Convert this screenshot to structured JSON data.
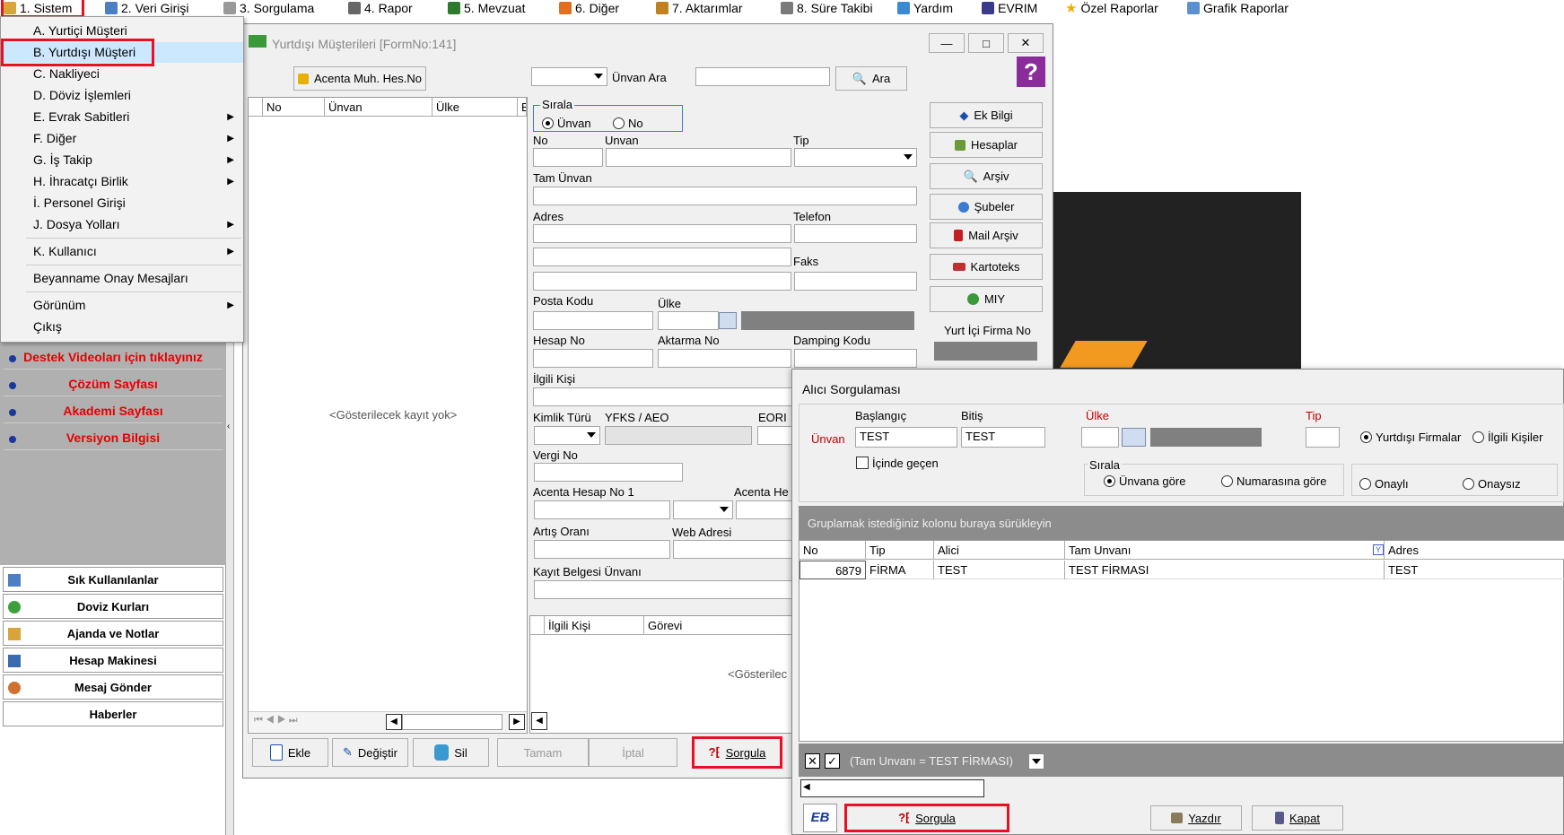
{
  "menubar": {
    "items": [
      {
        "label": "1.  Sistem"
      },
      {
        "label": "2.  Veri Girişi"
      },
      {
        "label": "3.  Sorgulama"
      },
      {
        "label": "4.  Rapor"
      },
      {
        "label": "5.  Mevzuat"
      },
      {
        "label": "6.  Diğer"
      },
      {
        "label": "7.  Aktarımlar"
      },
      {
        "label": "8. Süre Takibi"
      },
      {
        "label": "Yardım"
      },
      {
        "label": "EVRIM"
      },
      {
        "label": "Özel Raporlar"
      },
      {
        "label": "Grafik Raporlar"
      }
    ]
  },
  "dropdown": {
    "items": [
      {
        "label": "A.  Yurtiçi Müşteri"
      },
      {
        "label": "B.  Yurtdışı Müşteri"
      },
      {
        "label": "C.  Nakliyeci"
      },
      {
        "label": "D.  Döviz İşlemleri"
      },
      {
        "label": "E.  Evrak Sabitleri"
      },
      {
        "label": "F.  Diğer"
      },
      {
        "label": "G.  İş Takip"
      },
      {
        "label": "H.  İhracatçı Birlik"
      },
      {
        "label": "İ.   Personel Girişi"
      },
      {
        "label": "J.  Dosya Yolları"
      },
      {
        "label": "K.  Kullanıcı"
      },
      {
        "label": "Beyanname Onay Mesajları"
      },
      {
        "label": "Görünüm"
      },
      {
        "label": "Çıkış"
      }
    ]
  },
  "sidebar": {
    "links": [
      {
        "label": "Destek Videoları için tıklayınız"
      },
      {
        "label": "Çözüm Sayfası"
      },
      {
        "label": "Akademi Sayfası"
      },
      {
        "label": "Versiyon Bilgisi"
      }
    ],
    "buttons": [
      {
        "label": "Sık Kullanılanlar"
      },
      {
        "label": "Doviz Kurları"
      },
      {
        "label": "Ajanda ve Notlar"
      },
      {
        "label": "Hesap Makinesi"
      },
      {
        "label": "Mesaj Gönder"
      },
      {
        "label": "Haberler"
      }
    ]
  },
  "main_window": {
    "title": "Yurtdışı Müşterileri [FormNo:141]",
    "acenta_button": "Acenta Muh. Hes.No",
    "search_label": "Ünvan Ara",
    "search_button": "Ara",
    "grid_headers": [
      "No",
      "Ünvan",
      "Ülke",
      "Ekle"
    ],
    "empty_text": "<Gösterilecek kayıt yok>",
    "sirala_title": "Sırala",
    "sirala_options": [
      "Ünvan",
      "No"
    ],
    "labels": {
      "no": "No",
      "unvan": "Unvan",
      "tip": "Tip",
      "tam_unvan": "Tam Ünvan",
      "adres": "Adres",
      "telefon": "Telefon",
      "faks": "Faks",
      "posta_kodu": "Posta Kodu",
      "ulke": "Ülke",
      "hesap_no": "Hesap No",
      "aktarma_no": "Aktarma No",
      "damping_kodu": "Damping Kodu",
      "ilgili_kisi": "İlgili Kişi",
      "kimlik_turu": "Kimlik Türü",
      "yfks": "YFKS / AEO",
      "eori": "EORI",
      "vergi_no": "Vergi No",
      "acenta_hesap_no1": "Acenta Hesap No 1",
      "acenta_he": "Acenta He",
      "artis_orani": "Artış Oranı",
      "web_adresi": "Web Adresi",
      "kayit_belgesi": "Kayıt Belgesi Ünvanı"
    },
    "contact_headers": [
      "İlgili Kişi",
      "Görevi"
    ],
    "contact_empty": "<Gösterilec",
    "right_buttons": [
      "Ek Bilgi",
      "Hesaplar",
      "Arşiv",
      "Şubeler",
      "Mail Arşiv",
      "Kartoteks",
      "MIY"
    ],
    "yurt_ici_label": "Yurt İçi Firma No",
    "bottom_buttons": {
      "ekle": "Ekle",
      "degistir": "Değiştir",
      "sil": "Sil",
      "tamam": "Tamam",
      "iptal": "İptal",
      "sorgula": "Sorgula"
    }
  },
  "query_window": {
    "title": "Alıcı Sorgulaması",
    "unvan_label": "Ünvan",
    "baslangic_label": "Başlangıç",
    "bitis_label": "Bitiş",
    "baslangic_value": "TEST",
    "bitis_value": "TEST",
    "icinde_gecen": "İçinde geçen",
    "ulke_label": "Ülke",
    "tip_label": "Tip",
    "firma_options": [
      "Yurtdışı Firmalar",
      "İlgili Kişiler"
    ],
    "sirala_title": "Sırala",
    "sirala_options": [
      "Ünvana göre",
      "Numarasına göre"
    ],
    "onay_options": [
      "Onaylı",
      "Onaysız"
    ],
    "group_hint": "Gruplamak istediğiniz kolonu buraya sürükleyin",
    "headers": [
      "No",
      "Tip",
      "Alici",
      "Tam Unvanı",
      "Adres"
    ],
    "rows": [
      {
        "no": "6879",
        "tip": "FİRMA",
        "alici": "TEST",
        "tam_unvani": "TEST FİRMASI",
        "adres": "TEST"
      }
    ],
    "filter_text": "(Tam Unvanı = TEST FİRMASI)",
    "buttons": {
      "sorgula": "Sorgula",
      "yazdir": "Yazdır",
      "kapat": "Kapat"
    }
  },
  "colors": {
    "highlight_red": "#e81123",
    "link_red": "#e60000",
    "title_bar": "#f0f0f0",
    "selection": "#cce8ff"
  }
}
